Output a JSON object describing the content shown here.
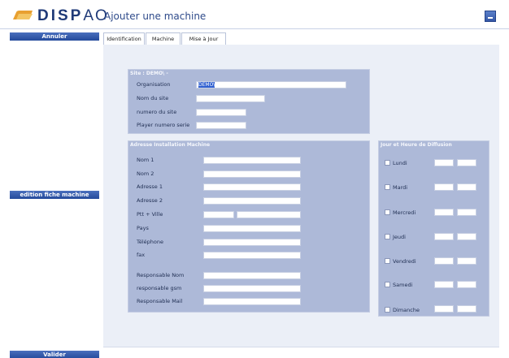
{
  "app": {
    "logo_text_bold": "DISP",
    "logo_text_light": "AO",
    "page_title": "Ajouter une machine"
  },
  "sidebar": {
    "cancel_label": "Annuler",
    "edit_label": "edition fiche machine",
    "validate_label": "Valider"
  },
  "tabs": [
    {
      "label": "Identification",
      "active": true
    },
    {
      "label": "Machine",
      "active": false
    },
    {
      "label": "Mise à Jour",
      "active": false
    }
  ],
  "site": {
    "title": "Site : DEMO\\ -",
    "organisation_label": "Organisation",
    "organisation_value": "DEMO\\",
    "nom_label": "Nom du site",
    "numero_label": "numero du site",
    "player_label": "Player numero serie"
  },
  "address": {
    "title": "Adresse Installation Machine",
    "fields": [
      {
        "label": "Nom 1"
      },
      {
        "label": "Nom 2"
      },
      {
        "label": "Adresse 1"
      },
      {
        "label": "Adresse 2"
      },
      {
        "label": "Ptt + Ville"
      },
      {
        "label": "Pays"
      },
      {
        "label": "Téléphone"
      },
      {
        "label": "fax"
      },
      {
        "label": "Responsable Nom"
      },
      {
        "label": "responsable gsm"
      },
      {
        "label": "Responsable Mail"
      }
    ]
  },
  "schedule": {
    "title": "Jour et Heure de Diffusion",
    "days": [
      {
        "label": "Lundi"
      },
      {
        "label": "Mardi"
      },
      {
        "label": "Mercredi"
      },
      {
        "label": "Jeudi"
      },
      {
        "label": "Vendredi"
      },
      {
        "label": "Samedi"
      },
      {
        "label": "Dimanche"
      }
    ]
  }
}
